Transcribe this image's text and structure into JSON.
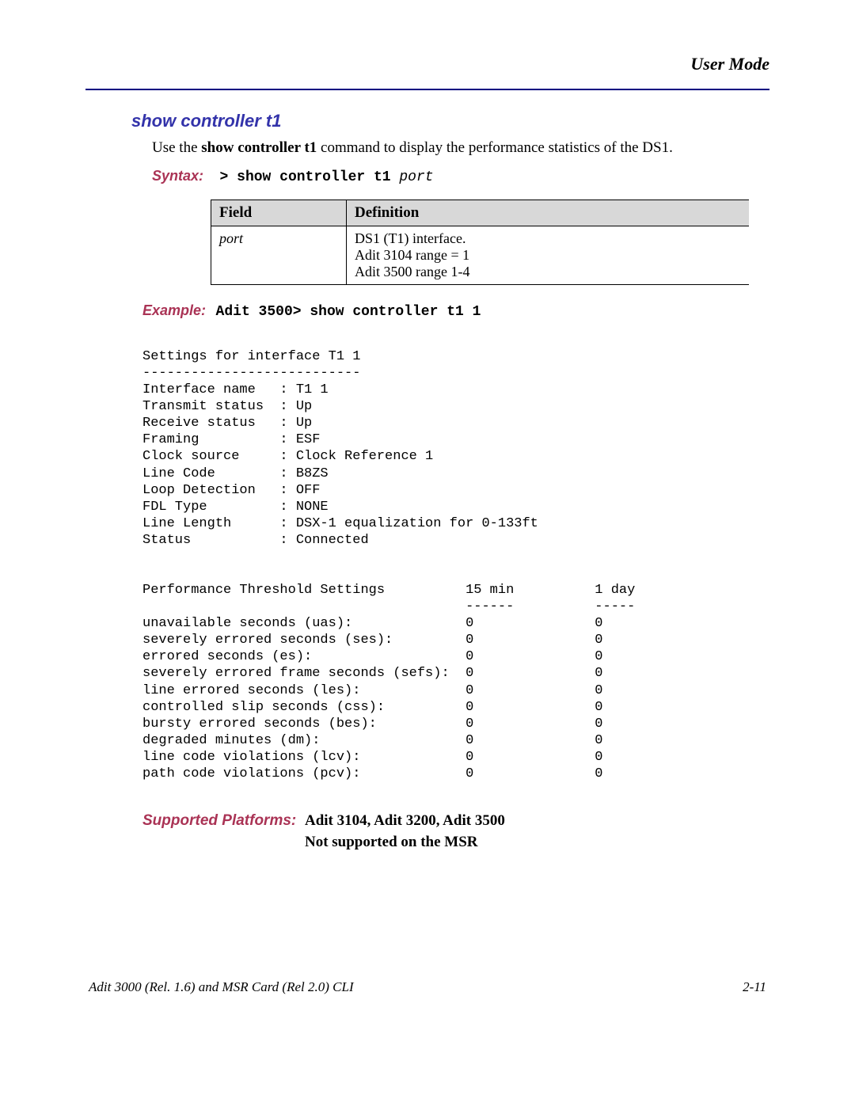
{
  "header": {
    "section": "User Mode"
  },
  "title": "show controller t1",
  "intro": {
    "prefix": "Use the ",
    "command": "show controller t1",
    "suffix": " command to display the performance statistics of the DS1."
  },
  "syntax": {
    "label": "Syntax:",
    "prompt": "> ",
    "command": "show controller t1 ",
    "arg": "port"
  },
  "table": {
    "headers": {
      "field": "Field",
      "definition": "Definition"
    },
    "rows": [
      {
        "field": "port",
        "def_line1": "DS1 (T1) interface.",
        "def_line2": "Adit 3104 range = 1",
        "def_line3": "Adit 3500 range 1-4"
      }
    ]
  },
  "example": {
    "label": "Example:",
    "text": "Adit 3500> show controller t1 1"
  },
  "cli_output": "Settings for interface T1 1\n---------------------------\nInterface name   : T1 1\nTransmit status  : Up\nReceive status   : Up\nFraming          : ESF\nClock source     : Clock Reference 1\nLine Code        : B8ZS\nLoop Detection   : OFF\nFDL Type         : NONE\nLine Length      : DSX-1 equalization for 0-133ft\nStatus           : Connected\n\n\nPerformance Threshold Settings          15 min          1 day\n                                        ------          -----\nunavailable seconds (uas):              0               0\nseverely errored seconds (ses):         0               0\nerrored seconds (es):                   0               0\nseverely errored frame seconds (sefs):  0               0\nline errored seconds (les):             0               0\ncontrolled slip seconds (css):          0               0\nbursty errored seconds (bes):           0               0\ndegraded minutes (dm):                  0               0\nline code violations (lcv):             0               0\npath code violations (pcv):             0               0",
  "supported": {
    "label": "Supported Platforms:",
    "line1": "Adit 3104, Adit 3200, Adit 3500",
    "line2": "Not supported on the MSR"
  },
  "footer": {
    "left": "Adit 3000 (Rel. 1.6) and MSR Card (Rel 2.0) CLI",
    "right": "2-11"
  }
}
